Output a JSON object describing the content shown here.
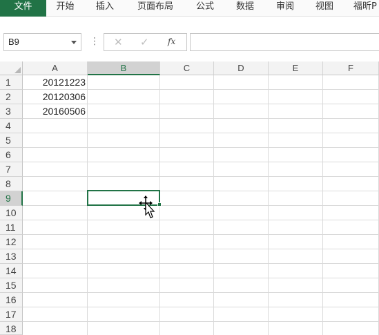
{
  "ribbon": {
    "tabs": [
      "文件",
      "开始",
      "插入",
      "页面布局",
      "公式",
      "数据",
      "审阅",
      "视图",
      "福昕P"
    ],
    "active_tab": "文件",
    "active_color": "#217346"
  },
  "formula_bar": {
    "name_box": "B9",
    "cancel_icon": "✕",
    "enter_icon": "✓",
    "fx_label": "fx",
    "content": ""
  },
  "sheet": {
    "column_headers": [
      "A",
      "B",
      "C",
      "D",
      "E",
      "F"
    ],
    "selected_column": "B",
    "row_headers": [
      "1",
      "2",
      "3",
      "4",
      "5",
      "6",
      "7",
      "8",
      "9",
      "10",
      "11",
      "12",
      "13",
      "14",
      "15",
      "16",
      "17",
      "18"
    ],
    "selected_row": "9",
    "cells": {
      "A1": "20121223",
      "A2": "20120306",
      "A3": "20160506"
    },
    "active_cell": "B9",
    "grid_color": "#dadada",
    "selection_color": "#217346"
  }
}
